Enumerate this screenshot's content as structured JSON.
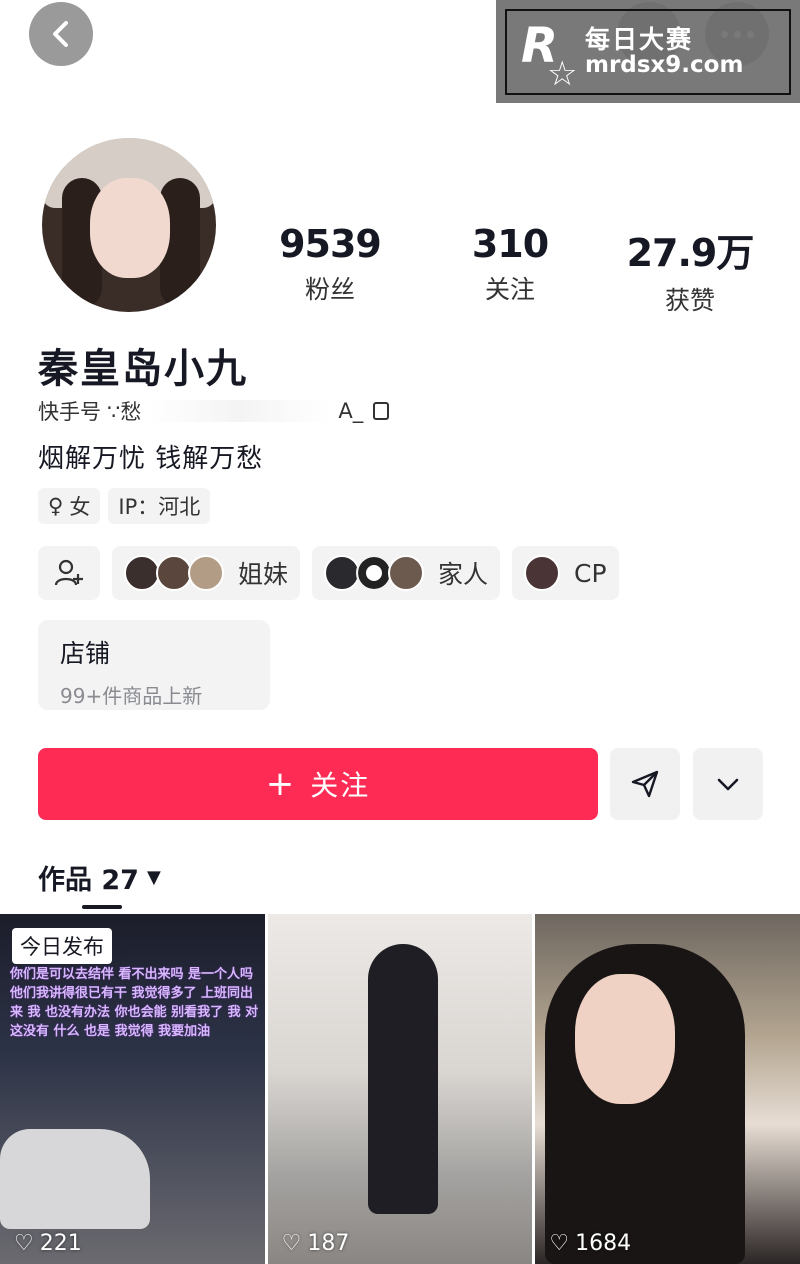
{
  "watermark": {
    "title": "每日大赛",
    "url": "mrdsx9.com",
    "logo_letter": "R"
  },
  "profile": {
    "nickname": "秦皇岛小九",
    "kuaishou_label": "快手号",
    "kuaishou_id_start": "∵愁",
    "kuaishou_id_end": "A_",
    "bio": "烟解万忧 钱解万愁"
  },
  "stats": [
    {
      "value": "9539",
      "label": "粉丝"
    },
    {
      "value": "310",
      "label": "关注"
    },
    {
      "value": "27.9万",
      "label": "获赞"
    }
  ],
  "tags": {
    "gender": "女",
    "ip": "IP：河北"
  },
  "groups": [
    {
      "label": "姐妹"
    },
    {
      "label": "家人"
    },
    {
      "label": "CP"
    }
  ],
  "shop": {
    "title": "店铺",
    "subtitle": "99+件商品上新"
  },
  "follow": {
    "label": "关注",
    "plus": "+"
  },
  "works": {
    "label": "作品 27"
  },
  "videos": [
    {
      "badge": "今日发布",
      "caption": "你们是可以去结伴 看不出来吗 是一个人吗 他们我讲得很已有干 我觉得多了 上班同出来 我 也没有办法 你也会能 别看我了 我 对这没有 什么 也是 我觉得 我要加油",
      "likes": "221"
    },
    {
      "likes": "187"
    },
    {
      "likes": "1684"
    }
  ],
  "colors": {
    "accent": "#fe2c55"
  }
}
